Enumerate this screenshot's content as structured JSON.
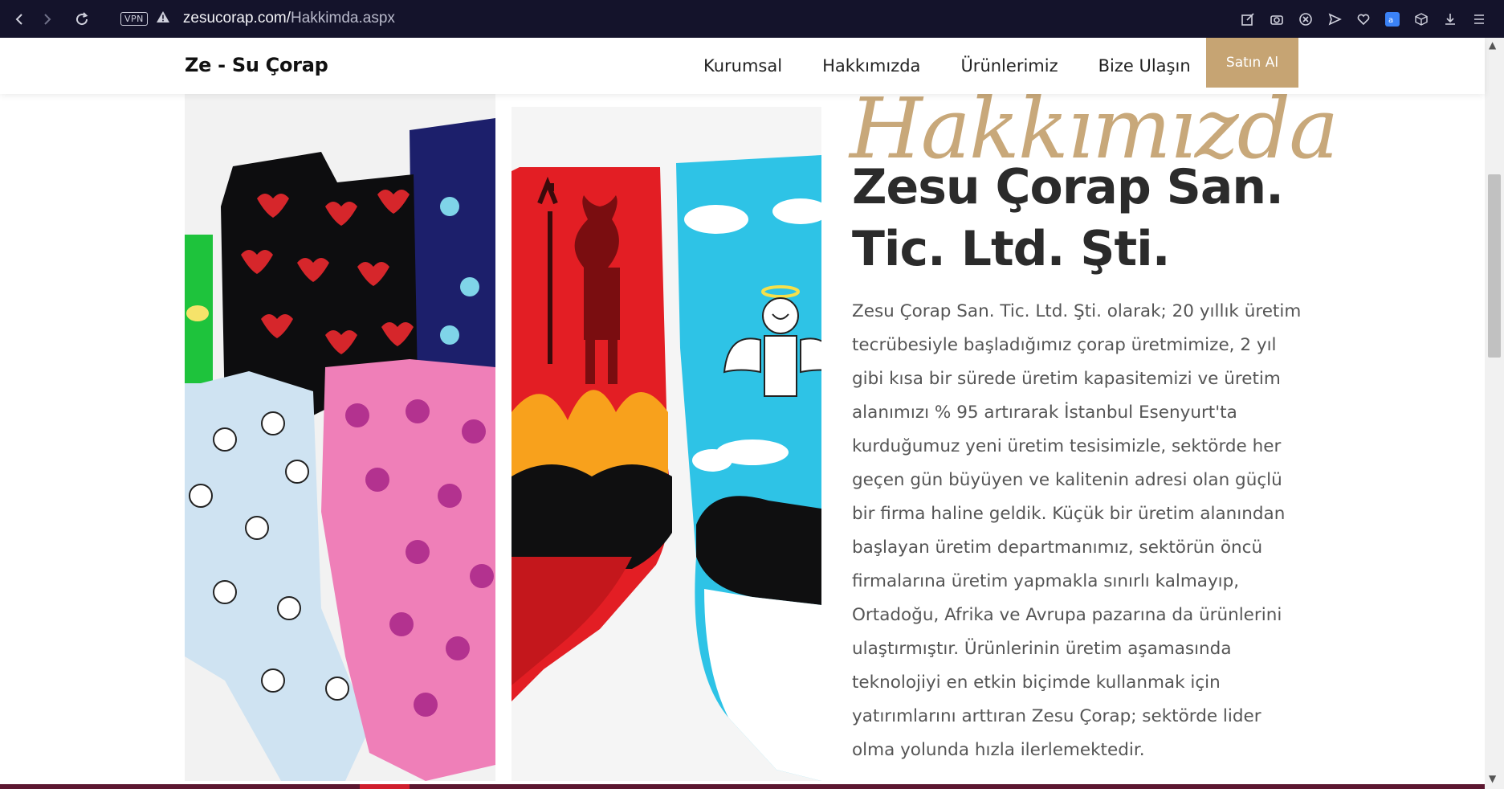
{
  "browser": {
    "vpn_label": "VPN",
    "url_domain": "zesucorap.com/",
    "url_path": "Hakkimda.aspx"
  },
  "header": {
    "brand": "Ze - Su Çorap",
    "nav": [
      {
        "label": "Kurumsal"
      },
      {
        "label": "Hakkımızda"
      },
      {
        "label": "Ürünlerimiz"
      },
      {
        "label": "Bize Ulaşın"
      }
    ],
    "buy_label": "Satın Al"
  },
  "main": {
    "script_title": "Hakkımızda",
    "company_title": "Zesu Çorap San. Tic. Ltd. Şti.",
    "about_text": "Zesu Çorap San. Tic. Ltd. Şti. olarak; 20 yıllık üretim tecrübesiyle başladığımız çorap üretmimize, 2 yıl gibi kısa bir sürede üretim kapasitemizi ve üretim alanımızı % 95 artırarak İstanbul Esenyurt'ta kurduğumuz yeni üretim tesisimizle, sektörde her geçen gün büyüyen ve kalitenin adresi olan güçlü bir firma haline geldik. Küçük bir üretim alanından başlayan üretim departmanımız, sektörün öncü firmalarına üretim yapmakla sınırlı kalmayıp, Ortadoğu, Afrika ve Avrupa pazarına da ürünlerini ulaştırmıştır. Ürünlerinin üretim aşamasında teknolojiyi en etkin biçimde kullanmak için yatırımlarını arttıran Zesu Çorap; sektörde lider olma yolunda hızla ilerlemektedir."
  },
  "colors": {
    "accent_gold": "#c6a473",
    "browser_bar": "#14132b",
    "heading": "#2b2b2b",
    "body_text": "#555555",
    "bottom_strip": "#5c1730"
  }
}
